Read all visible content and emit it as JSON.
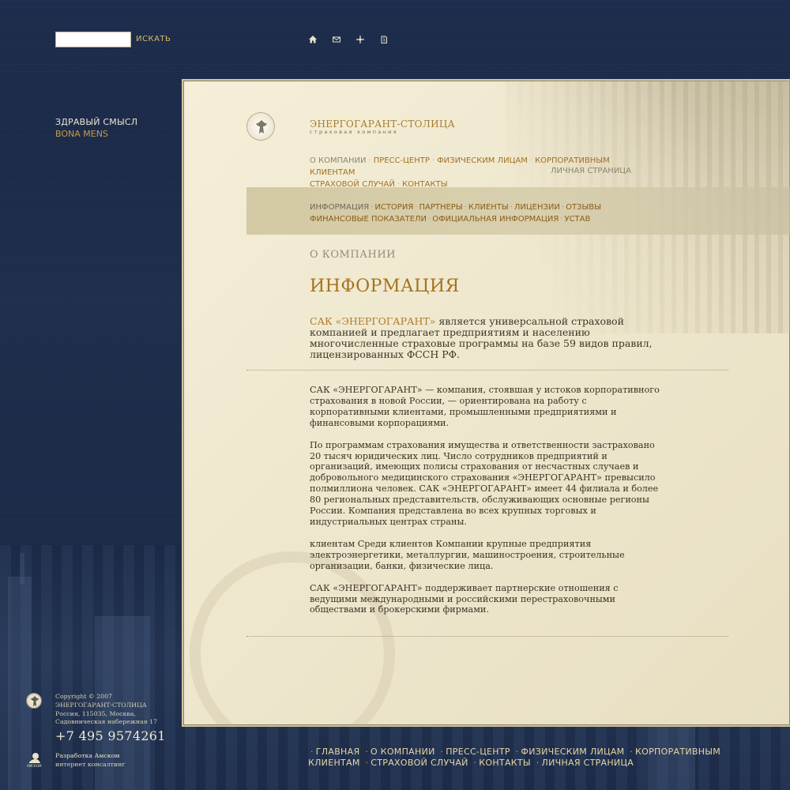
{
  "search": {
    "value": "",
    "button_label": "ИСКАТЬ"
  },
  "top_icons": [
    "home-icon",
    "mail-icon",
    "sitemap-icon",
    "print-icon"
  ],
  "slogan": {
    "line1": "ЗДРАВЫЙ СМЫСЛ",
    "line2": "BONA MENS"
  },
  "brand": {
    "name": "ЭНЕРГОГАРАНТ-СТОЛИЦА",
    "subtitle": "страховая компания"
  },
  "main_nav": {
    "items": [
      {
        "label": "О КОМПАНИИ",
        "active": true
      },
      {
        "label": "ПРЕСС-ЦЕНТР"
      },
      {
        "label": "ФИЗИЧЕСКИМ ЛИЦАМ"
      },
      {
        "label": "КОРПОРАТИВНЫМ КЛИЕНТАМ"
      },
      {
        "label": "СТРАХОВОЙ СЛУЧАЙ"
      },
      {
        "label": "КОНТАКТЫ"
      }
    ],
    "personal_label": "ЛИЧНАЯ СТРАНИЦА"
  },
  "sub_nav": {
    "items": [
      {
        "label": "ИНФОРМАЦИЯ",
        "active": true
      },
      {
        "label": "ИСТОРИЯ"
      },
      {
        "label": "ПАРТНЕРЫ"
      },
      {
        "label": "КЛИЕНТЫ"
      },
      {
        "label": "ЛИЦЕНЗИИ"
      },
      {
        "label": "ОТЗЫВЫ"
      },
      {
        "label": "ФИНАНСОВЫЕ ПОКАЗАТЕЛИ"
      },
      {
        "label": "ОФИЦИАЛЬНАЯ ИНФОРМАЦИЯ"
      },
      {
        "label": "УСТАВ"
      }
    ]
  },
  "content": {
    "breadcrumb": "О КОМПАНИИ",
    "title": "ИНФОРМАЦИЯ",
    "lead_brand": "САК «ЭНЕРГОГАРАНТ»",
    "lead_rest": " является универсальной страховой компанией и предлагает предприятиям и населению многочисленные страховые программы на базе 59 видов правил, лицензированных ФССН РФ.",
    "paragraphs": [
      "САК «ЭНЕРГОГАРАНТ» — компания, стоявшая у истоков корпоративного страхования в новой России, — ориентирована на работу с корпоративными клиентами, промышленными предприятиями и финансовыми корпорациями.",
      "По программам страхования имущества и ответственности застраховано 20 тысяч юридических лиц. Число сотрудников предприятий и организаций, имеющих полисы страхования от несчастных случаев и добровольного медицинского страхования «ЭНЕРГОГАРАНТ» превысило полмиллиона человек. САК «ЭНЕРГОГАРАНТ» имеет 44 филиала и более 80 региональных представительств, обслуживающих основные регионы России. Компания представлена во всех крупных торговых и индустриальных центрах страны.",
      "клиентам Среди клиентов Компании крупные предприятия электроэнергетики, металлургии, машиностроения, строительные организации, банки, физические лица.",
      "САК «ЭНЕРГОГАРАНТ» поддерживает партнерские отношения с ведущими международными и российскими перестраховочными обществами и брокерскими фирмами."
    ]
  },
  "footer": {
    "copyright": "Copyright © 2007",
    "company": "ЭНЕРГОГАРАНТ-СТОЛИЦА",
    "address1": "Россия, 115035, Москва,",
    "address2": "Садовническая набережная 17",
    "phone": "+7 495 9574261",
    "dev_line1": "Разработка Амском",
    "dev_line2": "интернет консалтинг",
    "dev_logo_text": "АМСКОМ",
    "nav": [
      "ГЛАВНАЯ",
      "О КОМПАНИИ",
      "ПРЕСС-ЦЕНТР",
      "ФИЗИЧЕСКИМ ЛИЦАМ",
      "КОРПОРАТИВНЫМ КЛИЕНТАМ",
      "СТРАХОВОЙ СЛУЧАЙ",
      "КОНТАКТЫ",
      "ЛИЧНАЯ СТРАНИЦА"
    ]
  },
  "colors": {
    "background": "#1c2b4b",
    "panel": "#f2ecd4",
    "accent": "#a4721c",
    "nav_gold": "#e6d6a4"
  }
}
